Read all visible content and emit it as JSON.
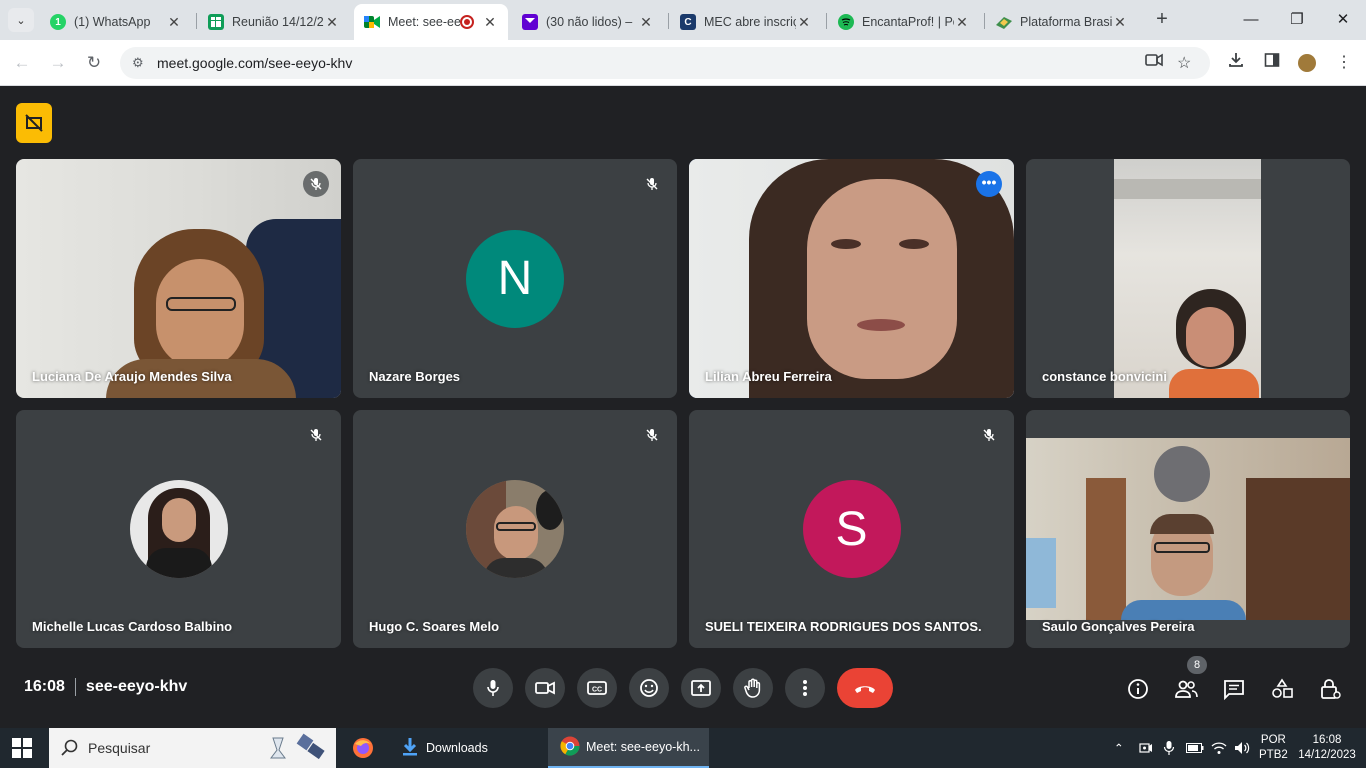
{
  "browser": {
    "tabs": [
      {
        "title": "(1) WhatsApp",
        "favicon_color": "#25d366",
        "favicon_glyph": "1"
      },
      {
        "title": "Reunião 14/12/2",
        "favicon_color": "#0f9d58",
        "favicon_glyph": ""
      },
      {
        "title": "Meet: see-ee",
        "favicon_color": "#00897b",
        "favicon_glyph": "",
        "recording": true
      },
      {
        "title": "(30 não lidos) – ",
        "favicon_color": "#6001d2",
        "favicon_glyph": ""
      },
      {
        "title": "MEC abre inscriç",
        "favicon_color": "#1a3a6b",
        "favicon_glyph": "C"
      },
      {
        "title": "EncantaProf! | Po",
        "favicon_color": "#1db954",
        "favicon_glyph": ""
      },
      {
        "title": "Plataforma Brasi",
        "favicon_color": "#3f8f4c",
        "favicon_glyph": ""
      }
    ],
    "url": "meet.google.com/see-eeyo-khv"
  },
  "participants": [
    {
      "name": "Luciana De Araujo Mendes Silva",
      "type": "video",
      "muted": true
    },
    {
      "name": "Nazare Borges",
      "type": "initial",
      "initial": "N",
      "color": "#00897b",
      "muted": true
    },
    {
      "name": "Lilian Abreu Ferreira",
      "type": "video",
      "speaking": true
    },
    {
      "name": "constance bonvicini",
      "type": "video"
    },
    {
      "name": "Michelle Lucas Cardoso Balbino",
      "type": "photo",
      "muted": true
    },
    {
      "name": "Hugo C. Soares Melo",
      "type": "photo",
      "muted": true
    },
    {
      "name": "SUELI TEIXEIRA RODRIGUES DOS SANTOS.",
      "type": "initial",
      "initial": "S",
      "color": "#c2185b",
      "muted": true
    },
    {
      "name": "Saulo Gonçalves Pereira",
      "type": "video"
    }
  ],
  "meeting": {
    "time": "16:08",
    "code": "see-eeyo-khv",
    "people_count": "8"
  },
  "taskbar": {
    "search_placeholder": "Pesquisar",
    "downloads_label": "Downloads",
    "chrome_label": "Meet: see-eeyo-kh...",
    "lang_top": "POR",
    "lang_bottom": "PTB2",
    "clock_time": "16:08",
    "clock_date": "14/12/2023"
  }
}
